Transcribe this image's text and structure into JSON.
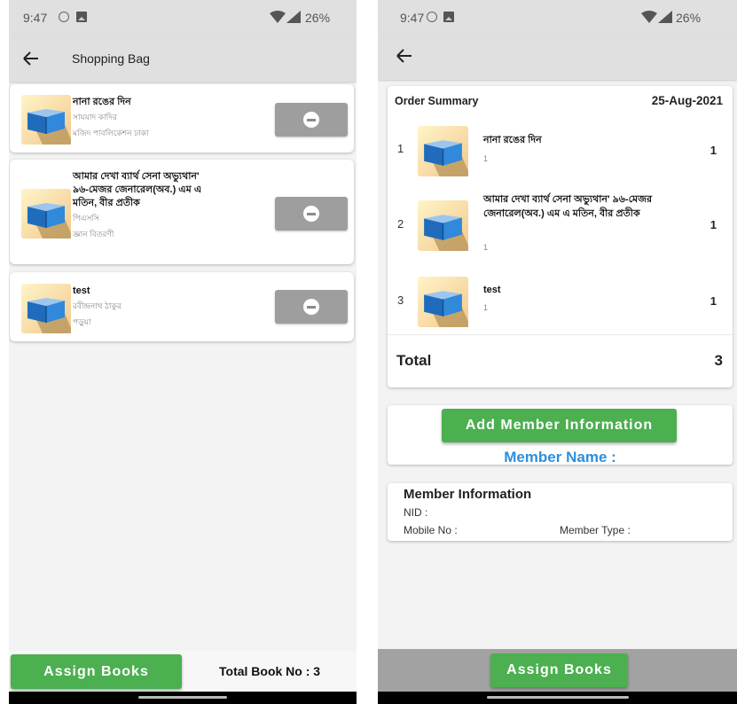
{
  "colors": {
    "accent_green": "#4caf50",
    "member_name_blue": "#2d8fdd",
    "remove_button_gray": "#9e9e9e",
    "app_bar_gray": "#e0e0e0"
  },
  "icons": {
    "back": "arrow-left-icon",
    "remove": "minus-circle-icon",
    "book": "book-cover-image"
  },
  "left": {
    "status_bar": {
      "time": "9:47",
      "battery": "26%"
    },
    "header": {
      "title": "Shopping Bag"
    },
    "items": [
      {
        "title": "নানা রঙের দিন",
        "author": "সাযযাদ কাদির",
        "publisher": "মজিদ পাবলিকেশন ঢাকা"
      },
      {
        "title": "আমার দেখা ব্যার্থ সেনা অভ্যুথান' ৯৬-মেজর জেনারেল(অব.) এম এ মতিন, বীর প্রতীক",
        "author": "পিএসসি",
        "publisher": "জ্ঞান বিতরণী"
      },
      {
        "title": "test",
        "author": "রবীন্দ্রনাথ ঠাকুর",
        "publisher": "পড়ুয়া"
      }
    ],
    "footer": {
      "assign_label": "Assign Books",
      "total_label": "Total Book No : 3"
    }
  },
  "right": {
    "status_bar": {
      "time": "9:47",
      "battery": "26%"
    },
    "order_summary": {
      "title": "Order Summary",
      "date": "25-Aug-2021",
      "items": [
        {
          "index": "1",
          "title": "নানা রঙের দিন",
          "subtitle": "1",
          "qty": "1"
        },
        {
          "index": "2",
          "title": "আমার দেখা ব্যার্থ সেনা অভ্যুথান' ৯৬-মেজর জেনারেল(অব.) এম এ মতিন, বীর প্রতীক",
          "subtitle": "1",
          "qty": "1"
        },
        {
          "index": "3",
          "title": "test",
          "subtitle": "1",
          "qty": "1"
        }
      ],
      "total_label": "Total",
      "total_value": "3"
    },
    "member": {
      "add_button": "Add Member Information",
      "name_label": "Member Name :"
    },
    "member_info": {
      "title": "Member Information",
      "nid": "NID :",
      "mobile": "Mobile No :",
      "type": "Member Type :"
    },
    "footer": {
      "assign_label": "Assign Books"
    }
  }
}
